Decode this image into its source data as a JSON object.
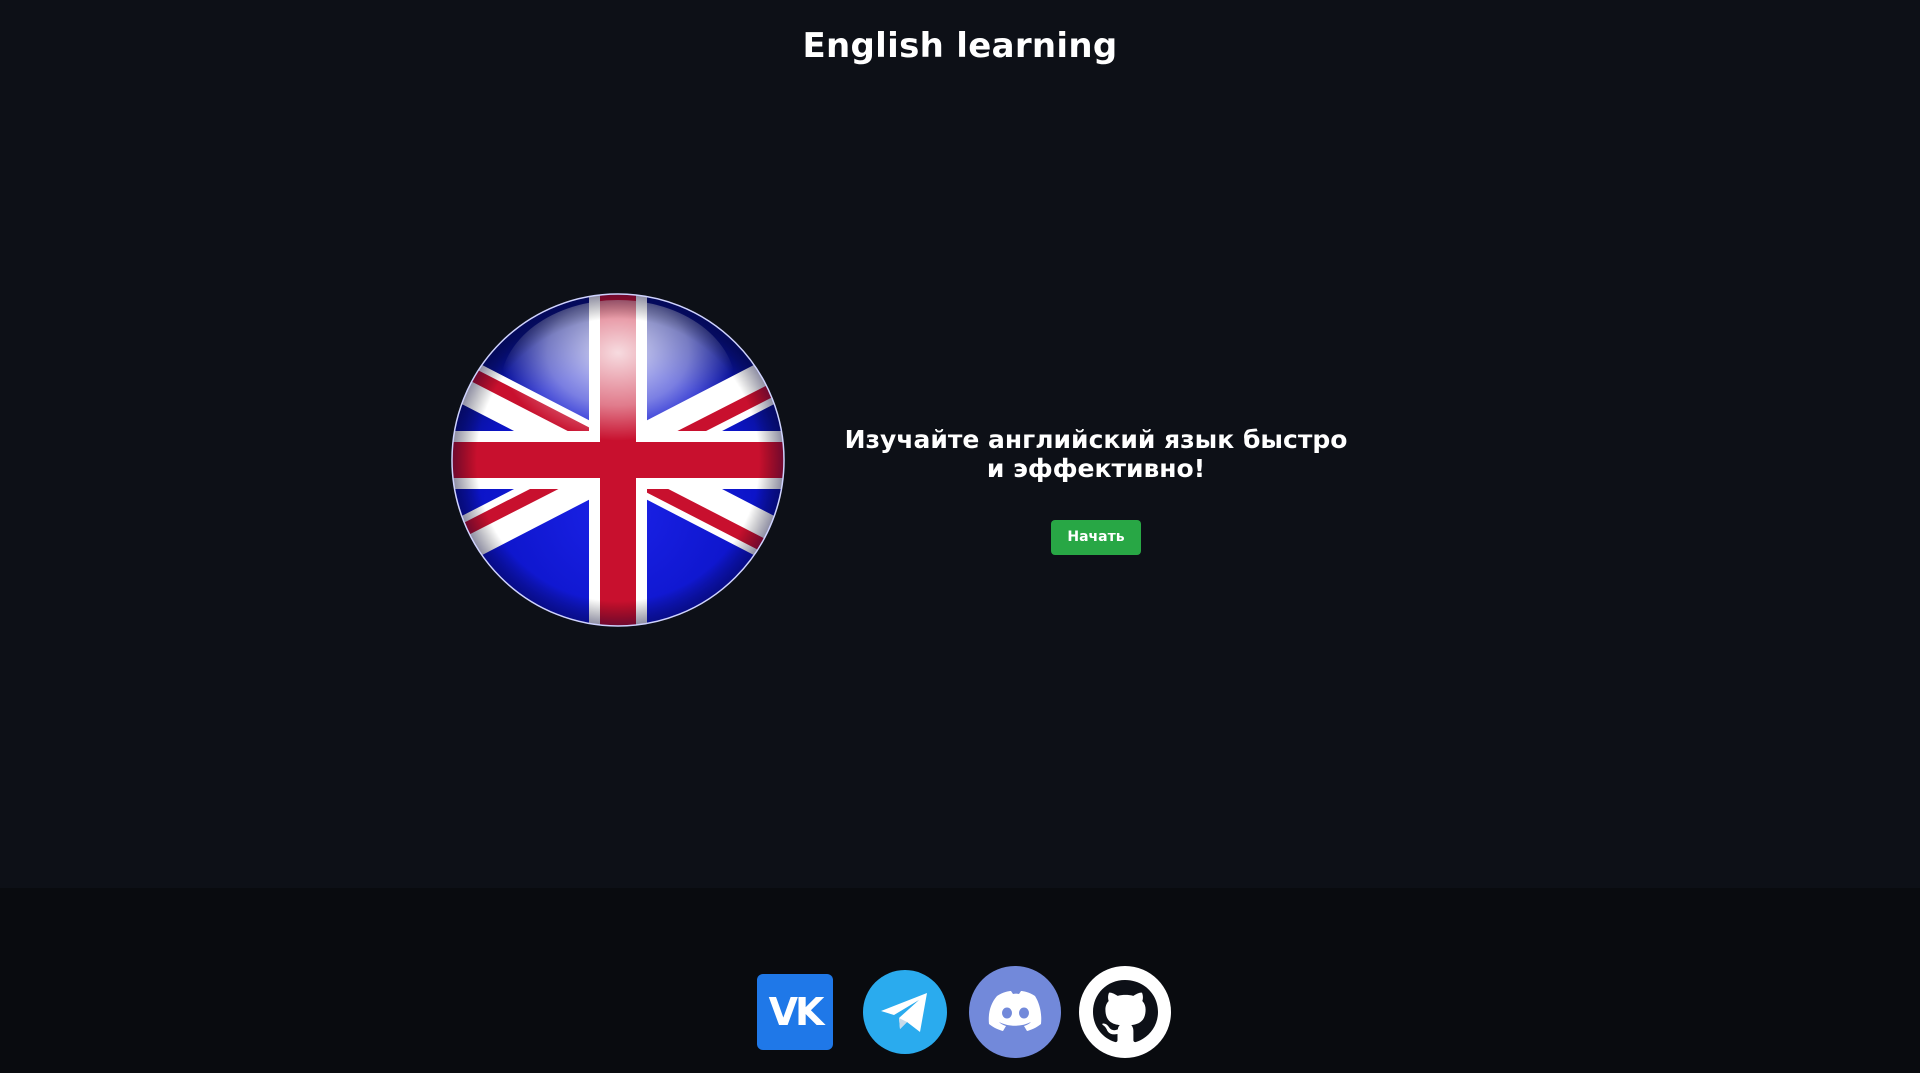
{
  "header": {
    "title": "English learning"
  },
  "hero": {
    "flag_icon": "uk-flag-icon",
    "tagline_line1": "Изучайте английский язык быстро",
    "tagline_line2": "и эффективно!",
    "start_label": "Начать",
    "start_color": "#28a745"
  },
  "footer": {
    "links": [
      {
        "icon": "vk-icon",
        "color": "#0077ff"
      },
      {
        "icon": "telegram-icon",
        "color": "#2aabee"
      },
      {
        "icon": "discord-icon",
        "color": "#7289da"
      },
      {
        "icon": "github-icon",
        "color": "#ffffff"
      }
    ]
  },
  "colors": {
    "background": "#0d1017",
    "footer_background": "#090b0f"
  }
}
